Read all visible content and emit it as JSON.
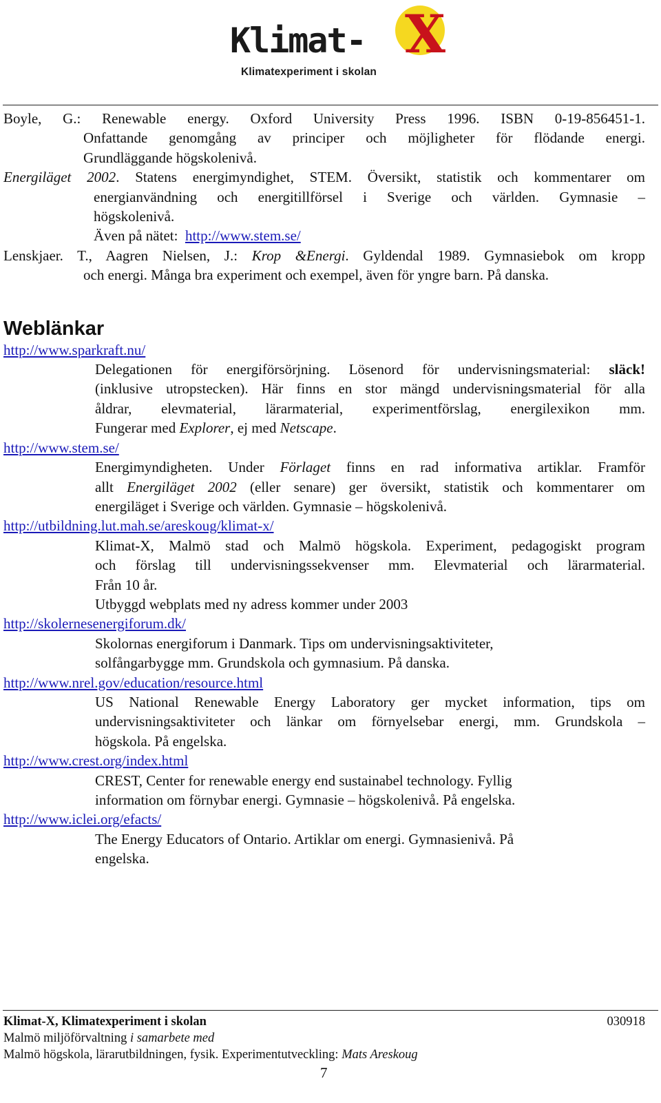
{
  "logo": {
    "word": "Klimat-",
    "x_mark": "X",
    "subtitle": "Klimatexperiment i skolan",
    "colors": {
      "circle": "#f5d820",
      "x": "#c8121b",
      "text": "#1a1a1a"
    }
  },
  "references": [
    {
      "line1": "Boyle, G.: Renewable energy. Oxford University Press 1996. ISBN 0-19-856451-1.",
      "line2": "Onfattande genomgång av principer och möjligheter för flödande energi.",
      "line3": "Grundläggande högskolenivå."
    },
    {
      "title_italic": "Energiläget 2002",
      "rest1": ". Statens energimyndighet, STEM. Översikt, statistik och kommentarer om",
      "line2": "energianvändning och energitillförsel i Sverige och världen. Gymnasie –",
      "line3": "högskolenivå.",
      "online_label": "Även på nätet:",
      "online_link": "http://www.stem.se/"
    },
    {
      "authors": "Lenskjaer. T., Aagren Nielsen, J.: ",
      "title_italic": "Krop &Energi",
      "rest1": ". Gyldendal 1989. Gymnasiebok om kropp",
      "line2": "och energi. Många bra experiment och exempel, även för yngre barn. På danska."
    }
  ],
  "weblinks": {
    "heading": "Weblänkar",
    "entries": [
      {
        "url": "http://www.sparkraft.nu/",
        "l1a": "Delegationen för energiförsörjning. Lösenord för undervisningsmaterial: ",
        "l1bold": "släck!",
        "l2": "(inklusive utropstecken). Här finns en stor mängd undervisningsmaterial för alla",
        "l3": "åldrar, elevmaterial, lärarmaterial, experimentförslag, energilexikon mm.",
        "l4a": "Fungerar med ",
        "l4i1": "Explorer",
        "l4b": ", ej med ",
        "l4i2": "Netscape",
        "l4c": "."
      },
      {
        "url": "http://www.stem.se/",
        "l1a": "Energimyndigheten. Under ",
        "l1i": "Förlaget",
        "l1b": " finns en rad informativa artiklar. Framför",
        "l2a": "allt ",
        "l2i": "Energiläget 2002",
        "l2b": " (eller senare) ger översikt, statistik och kommentarer om",
        "l3": "energiläget i Sverige och världen. Gymnasie – högskolenivå."
      },
      {
        "url": "http://utbildning.lut.mah.se/areskoug/klimat-x/",
        "l1": "Klimat-X, Malmö stad och Malmö högskola. Experiment, pedagogiskt program",
        "l2": "och förslag till undervisningssekvenser mm. Elevmaterial och lärarmaterial.",
        "l3": "Från 10 år.",
        "l4": "Utbyggd webplats med ny adress kommer under 2003"
      },
      {
        "url": "http://skolernesenergiforum.dk/",
        "l1": "Skolornas energiforum i Danmark. Tips om undervisningsaktiviteter,",
        "l2": "solfångarbygge mm. Grundskola och gymnasium. På danska."
      },
      {
        "url": "http://www.nrel.gov/education/resource.html",
        "l1": "US National Renewable Energy Laboratory ger mycket information, tips om",
        "l2": "undervisningsaktiviteter och länkar om förnyelsebar energi, mm. Grundskola –",
        "l3": "högskola. På engelska."
      },
      {
        "url": "http://www.crest.org/index.html",
        "l1": "CREST, Center for renewable energy end sustainabel technology. Fyllig",
        "l2": "information om förnybar energi. Gymnasie – högskolenivå. På engelska."
      },
      {
        "url": "http://www.iclei.org/efacts/",
        "l1": "The Energy Educators of Ontario. Artiklar om energi. Gymnasienivå. På",
        "l2": "engelska."
      }
    ]
  },
  "footer": {
    "org_bold": "Klimat-X, Klimatexperiment i skolan",
    "date": "030918",
    "line2a": "Malmö miljöförvaltning ",
    "line2i": "i samarbete med",
    "line3a": "Malmö högskola, lärarutbildningen, fysik. Experimentutveckling: ",
    "line3i": "Mats Areskoug",
    "page_number": "7"
  },
  "colors": {
    "link": "#1a1ab8",
    "text": "#111111"
  }
}
